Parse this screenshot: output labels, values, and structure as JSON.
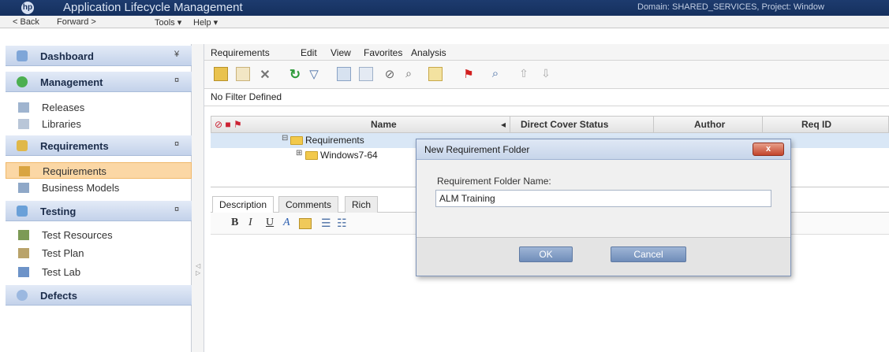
{
  "title_bar": {
    "logo": "hp",
    "title": "Application Lifecycle Management",
    "domain_text": "Domain: SHARED_SERVICES, Project: Window"
  },
  "menu_bar": {
    "back": "< Back",
    "forward": "Forward >",
    "tools": "Tools ▾",
    "help": "Help ▾"
  },
  "sidebar": {
    "groups": [
      {
        "label": "Dashboard",
        "chevron": "¥",
        "icon": "dashboard-icon",
        "color": "#7fa6d8"
      },
      {
        "label": "Management",
        "chevron": "¤",
        "icon": "management-icon",
        "color": "#4caf50"
      },
      {
        "label": "Requirements",
        "chevron": "¤",
        "icon": "requirements-group-icon",
        "color": "#e0b84a"
      },
      {
        "label": "Testing",
        "chevron": "¤",
        "icon": "testing-icon",
        "color": "#6aa0d8"
      },
      {
        "label": "Defects",
        "chevron": "",
        "icon": "defects-icon",
        "color": "#9bb8e0"
      }
    ],
    "items": [
      {
        "label": "Releases",
        "icon": "releases-icon"
      },
      {
        "label": "Libraries",
        "icon": "libraries-icon"
      },
      {
        "label": "Requirements",
        "icon": "requirements-icon",
        "selected": true
      },
      {
        "label": "Business Models",
        "icon": "business-models-icon"
      },
      {
        "label": "Test Resources",
        "icon": "test-resources-icon"
      },
      {
        "label": "Test Plan",
        "icon": "test-plan-icon"
      },
      {
        "label": "Test Lab",
        "icon": "test-lab-icon"
      }
    ]
  },
  "main": {
    "menu": [
      "Requirements",
      "Edit",
      "View",
      "Favorites",
      "Analysis"
    ],
    "filter_text": "No Filter Defined",
    "columns": [
      "Name",
      "Direct Cover Status",
      "Author",
      "Req ID"
    ],
    "tree": {
      "root": "Requirements",
      "child": "Windows7-64"
    },
    "tabs": [
      "Description",
      "Comments",
      "Rich"
    ],
    "editor_buttons": [
      "B",
      "I",
      "U",
      "A"
    ]
  },
  "dialog": {
    "title": "New Requirement Folder",
    "close_label": "x",
    "field_label": "Requirement Folder Name:",
    "field_value": "ALM Training",
    "ok_label": "OK",
    "cancel_label": "Cancel"
  }
}
